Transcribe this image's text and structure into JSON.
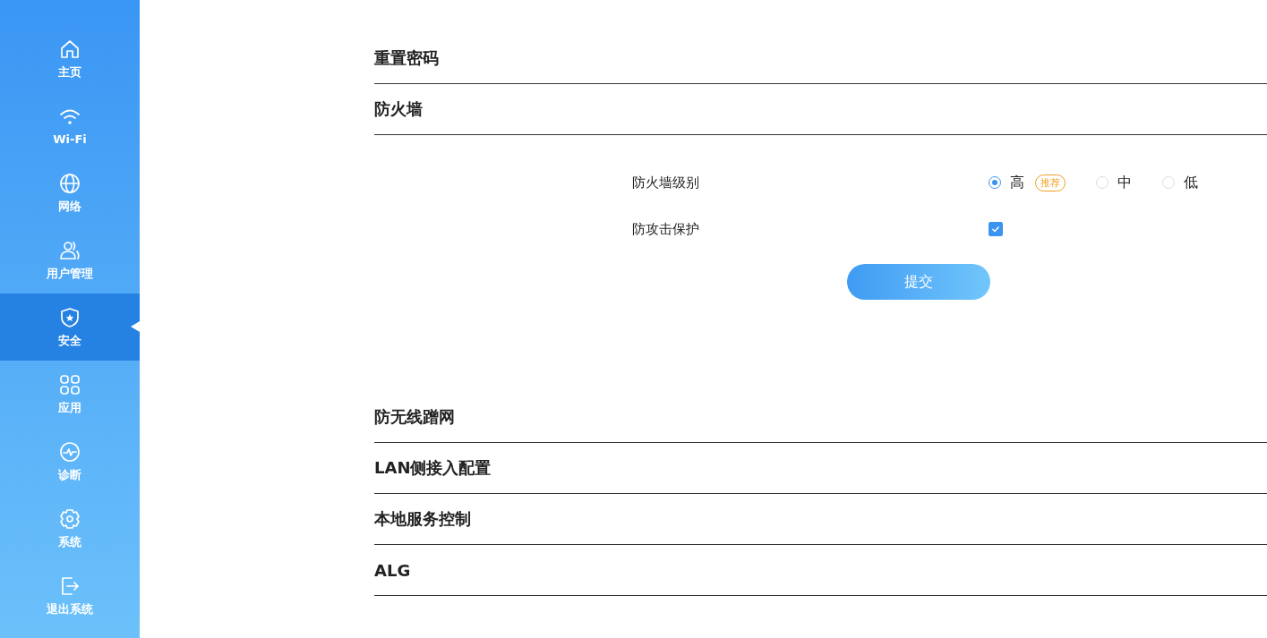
{
  "sidebar": {
    "items": [
      {
        "kind": "home",
        "label": "主页",
        "selected": false
      },
      {
        "kind": "wifi",
        "label": "Wi-Fi",
        "selected": false
      },
      {
        "kind": "globe",
        "label": "网络",
        "selected": false
      },
      {
        "kind": "users",
        "label": "用户管理",
        "selected": false
      },
      {
        "kind": "shield",
        "label": "安全",
        "selected": true
      },
      {
        "kind": "apps",
        "label": "应用",
        "selected": false
      },
      {
        "kind": "pulse",
        "label": "诊断",
        "selected": false
      },
      {
        "kind": "gear",
        "label": "系统",
        "selected": false
      },
      {
        "kind": "exit",
        "label": "退出系统",
        "selected": false
      }
    ]
  },
  "sections": [
    {
      "title": "重置密码"
    },
    {
      "title": "防火墙",
      "form": {
        "level": {
          "label": "防火墙级别",
          "options": [
            {
              "label": "高",
              "badge": "推荐",
              "selected": true
            },
            {
              "label": "中",
              "selected": false
            },
            {
              "label": "低",
              "selected": false
            }
          ]
        },
        "attack_protection": {
          "label": "防攻击保护",
          "checked": true
        },
        "submit": "提交"
      }
    },
    {
      "title": "防无线蹭网"
    },
    {
      "title": "LAN侧接入配置"
    },
    {
      "title": "本地服务控制"
    },
    {
      "title": "ALG"
    }
  ]
}
